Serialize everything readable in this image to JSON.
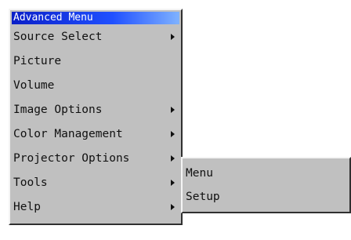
{
  "menu": {
    "title": "Advanced Menu",
    "items": [
      {
        "label": "Source Select",
        "has_submenu": true
      },
      {
        "label": "Picture",
        "has_submenu": false
      },
      {
        "label": "Volume",
        "has_submenu": false
      },
      {
        "label": "Image Options",
        "has_submenu": true
      },
      {
        "label": "Color Management",
        "has_submenu": true
      },
      {
        "label": "Projector Options",
        "has_submenu": true
      },
      {
        "label": "Tools",
        "has_submenu": true
      },
      {
        "label": "Help",
        "has_submenu": true
      }
    ]
  },
  "submenu": {
    "parent": "Projector Options",
    "items": [
      {
        "label": "Menu"
      },
      {
        "label": "Setup"
      }
    ]
  },
  "colors": {
    "menu_bg": "#c0c0c0",
    "title_bar_start": "#0a1fc8",
    "title_bar_end": "#7fb2ff",
    "title_text": "#ffffff"
  },
  "icons": {
    "submenu_indicator": "triangle-right-icon"
  }
}
